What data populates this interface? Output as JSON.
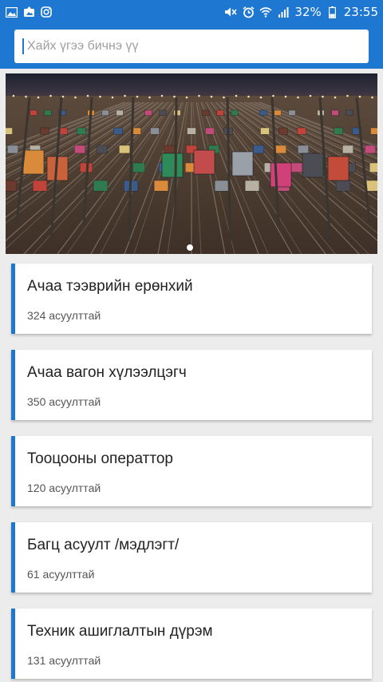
{
  "status_bar": {
    "battery": "32%",
    "time": "23:55",
    "icons_left": [
      "gallery-icon",
      "photo-upload-icon",
      "instagram-icon"
    ],
    "icons_right": [
      "mute-icon",
      "alarm-icon",
      "wifi-icon",
      "signal-icon",
      "battery-icon"
    ]
  },
  "search": {
    "placeholder": "Хайх үгээ бичнэ үү"
  },
  "banner": {
    "slides": 1,
    "active_slide": 1
  },
  "categories": [
    {
      "title": "Ачаа тээврийн ерөнхий",
      "count": "324 асуулттай"
    },
    {
      "title": "Ачаа вагон хүлээлцэгч",
      "count": "350 асуулттай"
    },
    {
      "title": "Тооцооны операттор",
      "count": "120 асуулттай"
    },
    {
      "title": "Багц асуулт /мэдлэгт/",
      "count": "61 асуулттай"
    },
    {
      "title": "Техник ашиглалтын дүрэм",
      "count": "131 асуулттай"
    }
  ],
  "colors": {
    "primary": "#1e78d2",
    "background": "#ececec"
  }
}
